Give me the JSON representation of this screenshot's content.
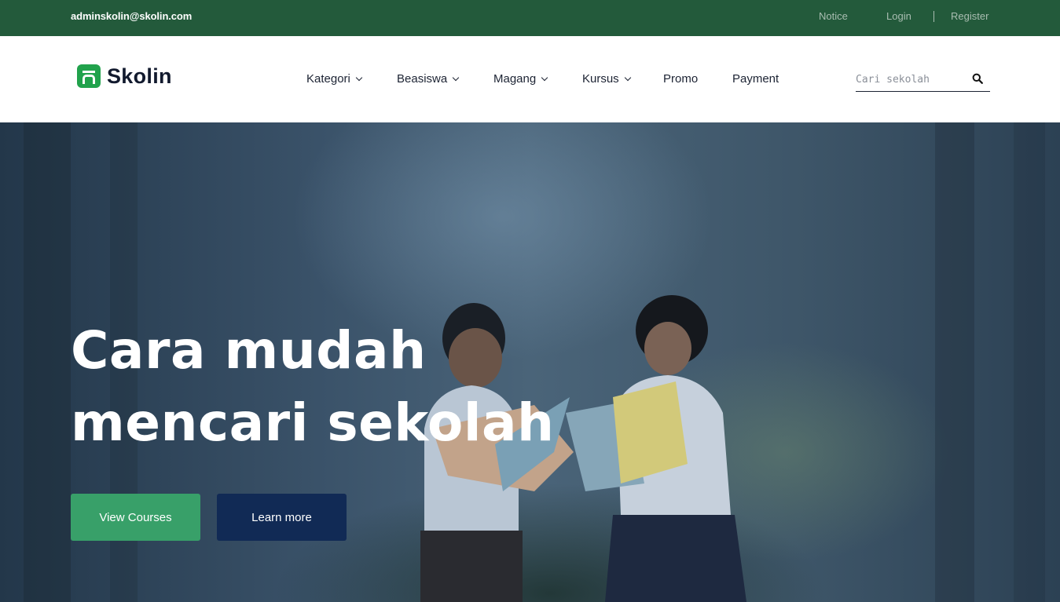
{
  "topbar": {
    "email": "adminskolin@skolin.com",
    "notice": "Notice",
    "login": "Login",
    "register": "Register"
  },
  "brand": {
    "name": "Skolin",
    "accent_color": "#21a24c"
  },
  "menu": {
    "items": [
      {
        "label": "Kategori",
        "has_dropdown": true
      },
      {
        "label": "Beasiswa",
        "has_dropdown": true
      },
      {
        "label": "Magang",
        "has_dropdown": true
      },
      {
        "label": "Kursus",
        "has_dropdown": true
      },
      {
        "label": "Promo",
        "has_dropdown": false
      },
      {
        "label": "Payment",
        "has_dropdown": false
      }
    ]
  },
  "search": {
    "placeholder": "Cari sekolah",
    "value": "",
    "icon": "search-icon"
  },
  "hero": {
    "title_line1": "Cara mudah",
    "title_line2": "mencari sekolah",
    "primary_button": "View Courses",
    "secondary_button": "Learn more",
    "primary_color": "#38a069",
    "secondary_color": "#112a55"
  },
  "colors": {
    "topbar_bg": "#235a3b",
    "text_dark": "#1c2333"
  }
}
